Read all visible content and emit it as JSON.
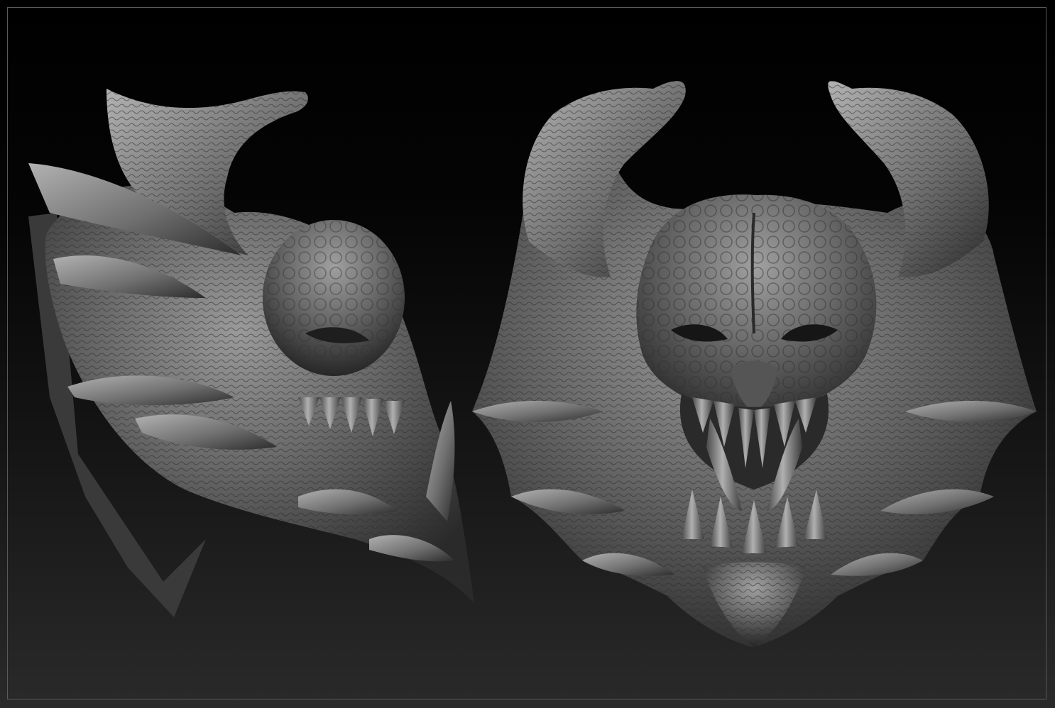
{
  "scene": {
    "description_free": true,
    "frame_color": "#5a5a5a",
    "material_base": "#6e6e6e",
    "material_light": "#a8a8a8",
    "material_dark": "#1e1e1e",
    "background_top": "#000000",
    "background_bottom": "#2a2a2a"
  },
  "objects": [
    {
      "name": "creature-head-side-view"
    },
    {
      "name": "creature-head-front-view"
    }
  ]
}
